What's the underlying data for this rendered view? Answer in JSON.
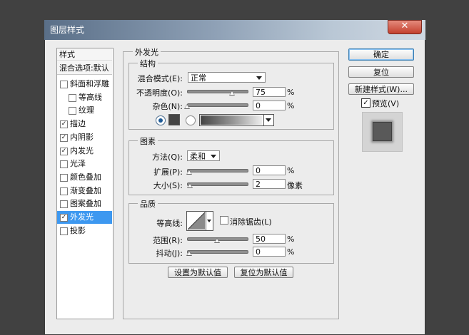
{
  "window": {
    "title": "图层样式",
    "close_label": "✕"
  },
  "left_panel": {
    "header_styles": "样式",
    "header_blend": "混合选项:默认",
    "items": [
      {
        "label": "斜面和浮雕",
        "checked": false,
        "indent": false
      },
      {
        "label": "等高线",
        "checked": false,
        "indent": true
      },
      {
        "label": "纹理",
        "checked": false,
        "indent": true
      },
      {
        "label": "描边",
        "checked": true,
        "indent": false
      },
      {
        "label": "内阴影",
        "checked": true,
        "indent": false
      },
      {
        "label": "内发光",
        "checked": true,
        "indent": false
      },
      {
        "label": "光泽",
        "checked": false,
        "indent": false
      },
      {
        "label": "颜色叠加",
        "checked": false,
        "indent": false
      },
      {
        "label": "渐变叠加",
        "checked": false,
        "indent": false
      },
      {
        "label": "图案叠加",
        "checked": false,
        "indent": false
      },
      {
        "label": "外发光",
        "checked": true,
        "indent": false,
        "selected": true
      },
      {
        "label": "投影",
        "checked": false,
        "indent": false
      }
    ],
    "check_glyph": "✓"
  },
  "main": {
    "section_title": "外发光",
    "structure": {
      "title": "结构",
      "blend_mode_label": "混合模式(E):",
      "blend_mode_value": "正常",
      "opacity_label": "不透明度(O):",
      "opacity_value": "75",
      "opacity_unit": "%",
      "opacity_level": 0.75,
      "noise_label": "杂色(N):",
      "noise_value": "0",
      "noise_unit": "%",
      "noise_level": 0,
      "color_swatch": "#454545"
    },
    "elements": {
      "title": "图素",
      "technique_label": "方法(Q):",
      "technique_value": "柔和",
      "spread_label": "扩展(P):",
      "spread_value": "0",
      "spread_unit": "%",
      "size_label": "大小(S):",
      "size_value": "2",
      "size_unit": "像素"
    },
    "quality": {
      "title": "品质",
      "contour_label": "等高线:",
      "anti_alias_label": "消除锯齿(L)",
      "range_label": "范围(R):",
      "range_value": "50",
      "range_unit": "%",
      "range_level": 0.5,
      "jitter_label": "抖动(J):",
      "jitter_value": "0",
      "jitter_unit": "%"
    },
    "make_default_label": "设置为默认值",
    "reset_default_label": "复位为默认值"
  },
  "right_panel": {
    "ok_label": "确定",
    "reset_label": "复位",
    "new_style_label": "新建样式(W)...",
    "preview_label": "预览(V)",
    "preview_checked": true
  },
  "colors": {
    "accent": "#3d98f0",
    "dialog_bg": "#ececec",
    "outer_bg": "#414141"
  }
}
